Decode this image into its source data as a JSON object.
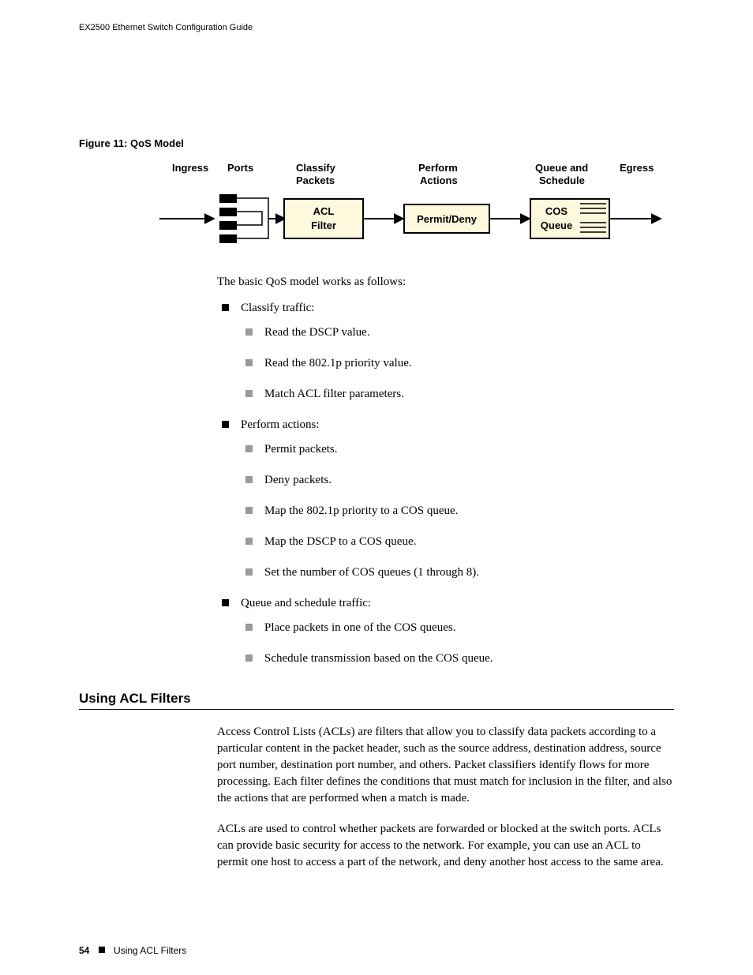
{
  "header": {
    "title": "EX2500 Ethernet Switch Configuration Guide"
  },
  "figure": {
    "caption": "Figure 11:  QoS Model",
    "labels": {
      "ingress": "Ingress",
      "ports": "Ports",
      "classify": "Classify Packets",
      "perform": "Perform Actions",
      "queue": "Queue and Schedule",
      "egress": "Egress"
    },
    "boxes": {
      "acl": "ACL Filter",
      "permit": "Permit/Deny",
      "cos": "COS Queue"
    }
  },
  "intro": "The basic QoS model works as follows:",
  "list": [
    {
      "text": "Classify traffic:",
      "children": [
        "Read the DSCP value.",
        "Read the 802.1p priority value.",
        "Match ACL filter parameters."
      ]
    },
    {
      "text": "Perform actions:",
      "children": [
        "Permit packets.",
        "Deny packets.",
        "Map the 802.1p priority to a COS queue.",
        "Map the DSCP to a COS queue.",
        "Set the number of COS queues (1 through 8)."
      ]
    },
    {
      "text": "Queue and schedule traffic:",
      "children": [
        "Place packets in one of the COS queues.",
        "Schedule transmission based on the COS queue."
      ]
    }
  ],
  "section": {
    "heading": "Using ACL Filters",
    "para1": "Access Control Lists (ACLs) are filters that allow you to classify data packets according to a particular content in the packet header, such as the source address, destination address, source port number, destination port number, and others. Packet classifiers identify flows for more processing. Each filter defines the conditions that must match for inclusion in the filter, and also the actions that are performed when a match is made.",
    "para2": "ACLs are used to control whether packets are forwarded or blocked at the switch ports. ACLs can provide basic security for access to the network. For example, you can use an ACL to permit one host to access a part of the network, and deny another host access to the same area."
  },
  "footer": {
    "page": "54",
    "section": "Using ACL Filters"
  },
  "chart_data": {
    "type": "diagram",
    "flow": [
      "Ingress",
      "Ports",
      "ACL Filter",
      "Permit/Deny",
      "COS Queue",
      "Egress"
    ],
    "top_labels": {
      "ACL Filter": "Classify Packets",
      "Permit/Deny": "Perform Actions",
      "COS Queue": "Queue and Schedule"
    }
  }
}
